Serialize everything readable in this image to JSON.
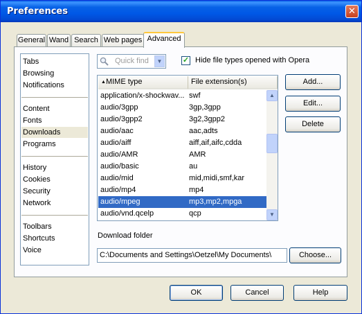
{
  "window": {
    "title": "Preferences",
    "close_glyph": "✕"
  },
  "tabs": [
    {
      "label": "General"
    },
    {
      "label": "Wand"
    },
    {
      "label": "Search"
    },
    {
      "label": "Web pages"
    },
    {
      "label": "Advanced",
      "active": true
    }
  ],
  "categories": {
    "items": [
      "Tabs",
      "Browsing",
      "Notifications",
      "Content",
      "Fonts",
      "Downloads",
      "Programs",
      "History",
      "Cookies",
      "Security",
      "Network",
      "Toolbars",
      "Shortcuts",
      "Voice"
    ],
    "selected": "Downloads"
  },
  "quick_find": {
    "placeholder": "Quick find",
    "icon": "magnifier-icon",
    "dropdown_glyph": "▼"
  },
  "hide_types": {
    "label": "Hide file types opened with Opera",
    "checked": true,
    "check_glyph": "✓"
  },
  "mime_table": {
    "columns": [
      "MIME type",
      "File extension(s)"
    ],
    "sort_glyph": "▲",
    "rows": [
      [
        "application/x-shockwav...",
        "swf"
      ],
      [
        "audio/3gpp",
        "3gp,3gpp"
      ],
      [
        "audio/3gpp2",
        "3g2,3gpp2"
      ],
      [
        "audio/aac",
        "aac,adts"
      ],
      [
        "audio/aiff",
        "aiff,aif,aifc,cdda"
      ],
      [
        "audio/AMR",
        "AMR"
      ],
      [
        "audio/basic",
        "au"
      ],
      [
        "audio/mid",
        "mid,midi,smf,kar"
      ],
      [
        "audio/mp4",
        "mp4"
      ],
      [
        "audio/mpeg",
        "mp3,mp2,mpga"
      ],
      [
        "audio/vnd.qcelp",
        "qcp"
      ]
    ],
    "selected_row": 9,
    "scroll_up_glyph": "▲",
    "scroll_down_glyph": "▼"
  },
  "side_buttons": {
    "add": "Add...",
    "edit": "Edit...",
    "delete": "Delete"
  },
  "download_folder": {
    "label": "Download folder",
    "path": "C:\\Documents and Settings\\Oetzel\\My Documents\\",
    "choose": "Choose..."
  },
  "footer": {
    "ok": "OK",
    "cancel": "Cancel",
    "help": "Help"
  },
  "colors": {
    "title_bar": "#0058e6",
    "selection": "#316ac5",
    "active_tab_accent": "#ffc83c"
  }
}
